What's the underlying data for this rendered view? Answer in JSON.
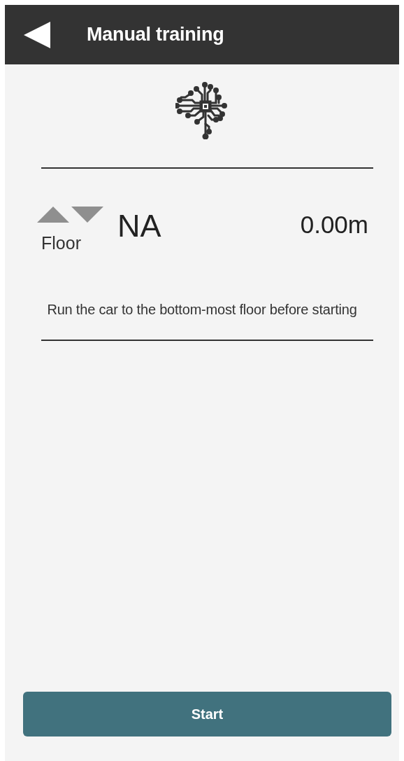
{
  "header": {
    "title": "Manual training"
  },
  "position": {
    "floor_label": "Floor",
    "floor_value": "NA",
    "distance": "0.00m"
  },
  "instruction": "Run the car to the bottom-most floor before starting",
  "buttons": [
    "Start"
  ]
}
